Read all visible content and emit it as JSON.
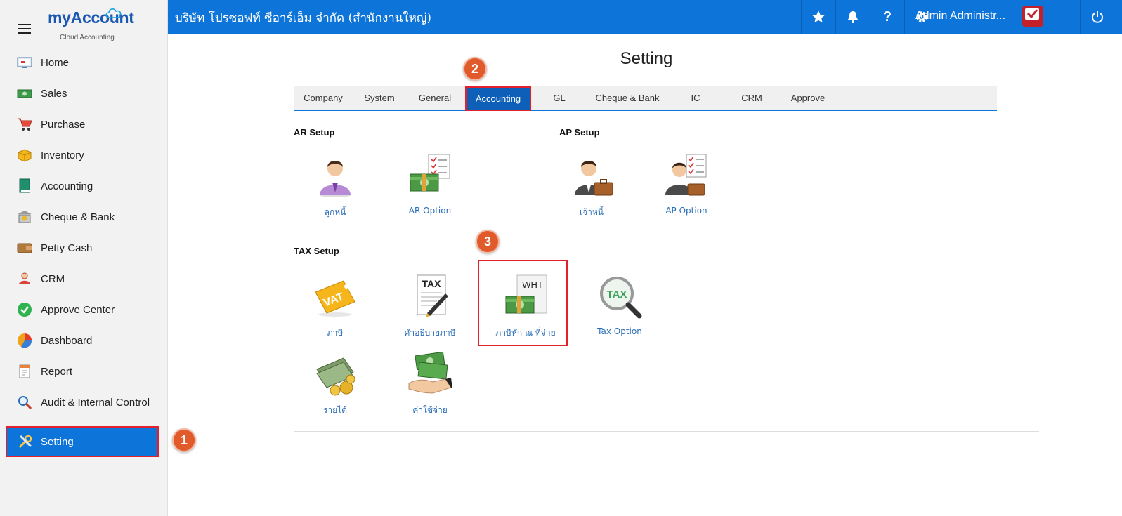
{
  "brand": {
    "name_my": "my",
    "name_account": "Account",
    "subtitle": "Cloud Accounting"
  },
  "sidebar": {
    "items": [
      {
        "label": "Home",
        "icon": "home-icon"
      },
      {
        "label": "Sales",
        "icon": "sales-icon"
      },
      {
        "label": "Purchase",
        "icon": "cart-icon"
      },
      {
        "label": "Inventory",
        "icon": "box-icon"
      },
      {
        "label": "Accounting",
        "icon": "book-icon"
      },
      {
        "label": "Cheque & Bank",
        "icon": "bank-icon"
      },
      {
        "label": "Petty Cash",
        "icon": "wallet-icon"
      },
      {
        "label": "CRM",
        "icon": "people-icon"
      },
      {
        "label": "Approve Center",
        "icon": "check-circle-icon"
      },
      {
        "label": "Dashboard",
        "icon": "pie-chart-icon"
      },
      {
        "label": "Report",
        "icon": "report-icon"
      },
      {
        "label": "Audit & Internal Control",
        "icon": "magnifier-icon"
      },
      {
        "label": "Setting",
        "icon": "tools-icon",
        "active": true
      }
    ]
  },
  "header": {
    "company": "บริษัท โปรซอฟท์ ซีอาร์เอ็ม จำกัด (สำนักงานใหญ่)",
    "user_name": "Admin Administr...",
    "icons": [
      "star-icon",
      "bell-icon",
      "help-icon",
      "gear-icon",
      "power-icon"
    ],
    "help_glyph": "?"
  },
  "main": {
    "title": "Setting",
    "tabs": [
      {
        "label": "Company"
      },
      {
        "label": "System"
      },
      {
        "label": "General"
      },
      {
        "label": "Accounting",
        "active": true
      },
      {
        "label": "GL"
      },
      {
        "label": "Cheque & Bank"
      },
      {
        "label": "IC"
      },
      {
        "label": "CRM"
      },
      {
        "label": "Approve"
      }
    ],
    "ar_setup": {
      "title": "AR Setup",
      "items": [
        {
          "label": "ลูกหนี้",
          "icon": "customer-person-icon"
        },
        {
          "label": "AR Option",
          "icon": "money-checklist-icon"
        }
      ]
    },
    "ap_setup": {
      "title": "AP Setup",
      "items": [
        {
          "label": "เจ้าหนี้",
          "icon": "businessman-briefcase-icon"
        },
        {
          "label": "AP Option",
          "icon": "businessman-checklist-icon"
        }
      ]
    },
    "tax_setup": {
      "title": "TAX Setup",
      "items": [
        {
          "label": "ภาษี",
          "icon": "vat-tag-icon",
          "icon_text": "VAT"
        },
        {
          "label": "คำอธิบายภาษี",
          "icon": "tax-document-pen-icon",
          "icon_text": "TAX"
        },
        {
          "label": "ภาษีหัก ณ ที่จ่าย",
          "icon": "wht-money-icon",
          "icon_text": "WHT"
        },
        {
          "label": "Tax Option",
          "icon": "tax-magnifier-icon",
          "icon_text": "TAX"
        }
      ]
    },
    "other": {
      "items": [
        {
          "label": "รายได้",
          "icon": "cash-coins-icon"
        },
        {
          "label": "ค่าใช้จ่าย",
          "icon": "money-hand-icon"
        }
      ]
    }
  },
  "annotations": {
    "badge1": "1",
    "badge2": "2",
    "badge3": "3"
  },
  "colors": {
    "primary": "#0d74d9",
    "highlight": "#e5202a",
    "badge": "#e05a2b",
    "link": "#2a6db8"
  }
}
